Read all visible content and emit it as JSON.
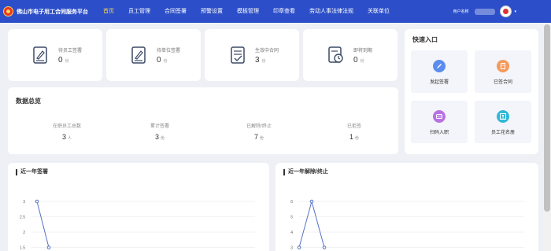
{
  "header": {
    "logo_text": "佛山市电子用工合同服务平台",
    "nav": [
      "首页",
      "员工管理",
      "合同签署",
      "预警设置",
      "模板管理",
      "印章查看",
      "劳动人事法律法规",
      "关联单位"
    ],
    "user_label": "用户名称",
    "caret": "▾"
  },
  "stats": [
    {
      "label": "待员工签署",
      "value": "0",
      "unit": "份",
      "icon": "sign-doc-icon"
    },
    {
      "label": "待单位签署",
      "value": "0",
      "unit": "份",
      "icon": "sign-doc-icon"
    },
    {
      "label": "生效中合同",
      "value": "3",
      "unit": "份",
      "icon": "contract-check-icon"
    },
    {
      "label": "即将到期",
      "value": "0",
      "unit": "份",
      "icon": "clock-doc-icon"
    }
  ],
  "overview": {
    "title": "数据总览",
    "items": [
      {
        "label": "在职员工总数",
        "value": "3",
        "unit": "人"
      },
      {
        "label": "累计签署",
        "value": "3",
        "unit": "份"
      },
      {
        "label": "已解除/终止",
        "value": "7",
        "unit": "份"
      },
      {
        "label": "已拒签",
        "value": "1",
        "unit": "份"
      }
    ]
  },
  "quick": {
    "title": "快速入口",
    "tiles": [
      {
        "label": "发起签署",
        "color": "#5b8def",
        "icon": "pen-icon"
      },
      {
        "label": "已签合同",
        "color": "#f59a5b",
        "icon": "document-icon"
      },
      {
        "label": "扫码入职",
        "color": "#b872e0",
        "icon": "scan-icon"
      },
      {
        "label": "员工花名册",
        "color": "#2fb8d8",
        "icon": "roster-icon"
      }
    ]
  },
  "charts": [
    {
      "title": "近一年签署",
      "y_ticks": [
        "3",
        "2.5",
        "2",
        "1.5"
      ]
    },
    {
      "title": "近一年解除/终止",
      "y_ticks": [
        "6",
        "5",
        "4",
        "3"
      ]
    }
  ],
  "chart_data": [
    {
      "type": "line",
      "title": "近一年签署",
      "ylim": [
        1.5,
        3
      ],
      "series": [
        {
          "values": [
            3,
            1.5
          ]
        }
      ],
      "grid": true
    },
    {
      "type": "line",
      "title": "近一年解除/终止",
      "ylim": [
        3,
        6
      ],
      "series": [
        {
          "values": [
            3,
            6,
            3
          ]
        }
      ],
      "grid": true
    }
  ],
  "colors": {
    "topbar": "#2c4fc9",
    "nav_active": "#ffd54f",
    "line": "#5470c6"
  }
}
